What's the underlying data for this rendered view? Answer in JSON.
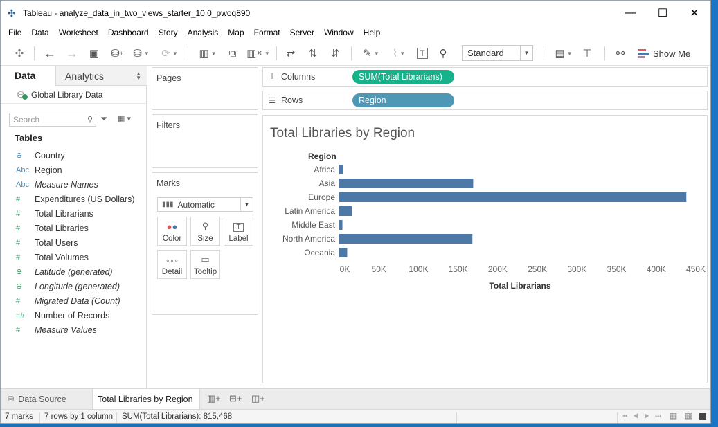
{
  "window": {
    "title": "Tableau - analyze_data_in_two_views_starter_10.0_pwoq890",
    "controls": [
      "—",
      "☐",
      "✕"
    ]
  },
  "menu": [
    "File",
    "Data",
    "Worksheet",
    "Dashboard",
    "Story",
    "Analysis",
    "Map",
    "Format",
    "Server",
    "Window",
    "Help"
  ],
  "toolbar": {
    "fit_select": "Standard",
    "show_me_label": "Show Me",
    "icons": [
      "tableau-logo-icon",
      "undo-icon",
      "redo-icon",
      "save-icon",
      "new-datasource-icon",
      "pause-updates-icon",
      "refresh-icon",
      "new-worksheet-icon",
      "duplicate-sheet-icon",
      "clear-sheet-icon",
      "swap-rows-columns-icon",
      "sort-ascending-icon",
      "sort-descending-icon",
      "highlight-icon",
      "group-members-icon",
      "show-labels-icon",
      "pin-axes-icon",
      "show-cards-icon",
      "presentation-mode-icon",
      "share-icon"
    ]
  },
  "data_pane": {
    "tab_data": "Data",
    "tab_analytics": "Analytics",
    "datasource_name": "Global Library Data",
    "search_placeholder": "Search",
    "tables_heading": "Tables",
    "fields": [
      {
        "icon": "⊕",
        "label": "Country",
        "kind": "dim",
        "italic": false
      },
      {
        "icon": "Abc",
        "label": "Region",
        "kind": "dim",
        "italic": false
      },
      {
        "icon": "Abc",
        "label": "Measure Names",
        "kind": "dim",
        "italic": true
      },
      {
        "icon": "#",
        "label": "Expenditures  (US Dollars)",
        "kind": "mea",
        "italic": false
      },
      {
        "icon": "#",
        "label": "Total Librarians",
        "kind": "mea",
        "italic": false
      },
      {
        "icon": "#",
        "label": "Total Libraries",
        "kind": "mea",
        "italic": false
      },
      {
        "icon": "#",
        "label": "Total Users",
        "kind": "mea",
        "italic": false
      },
      {
        "icon": "#",
        "label": "Total Volumes",
        "kind": "mea",
        "italic": false
      },
      {
        "icon": "⊕",
        "label": "Latitude (generated)",
        "kind": "mea",
        "italic": true
      },
      {
        "icon": "⊕",
        "label": "Longitude (generated)",
        "kind": "mea",
        "italic": true
      },
      {
        "icon": "#",
        "label": "Migrated Data (Count)",
        "kind": "mea",
        "italic": true
      },
      {
        "icon": "=#",
        "label": "Number of Records",
        "kind": "mea",
        "italic": false
      },
      {
        "icon": "#",
        "label": "Measure Values",
        "kind": "mea",
        "italic": true
      }
    ]
  },
  "cards": {
    "pages": "Pages",
    "filters": "Filters",
    "marks": "Marks",
    "mark_type": "Automatic",
    "mark_buttons": [
      {
        "label": "Color",
        "icon": "color-icon"
      },
      {
        "label": "Size",
        "icon": "size-icon"
      },
      {
        "label": "Label",
        "icon": "label-icon"
      },
      {
        "label": "Detail",
        "icon": "detail-icon"
      },
      {
        "label": "Tooltip",
        "icon": "tooltip-icon"
      }
    ]
  },
  "shelves": {
    "columns_label": "Columns",
    "columns_pill": "SUM(Total Librarians)",
    "rows_label": "Rows",
    "rows_pill": "Region",
    "columns_pill_color": "#17b28a",
    "rows_pill_color": "#4f98b5"
  },
  "chart_data": {
    "type": "bar",
    "orientation": "horizontal",
    "title": "Total Libraries by Region",
    "row_header": "Region",
    "categories": [
      "Africa",
      "Asia",
      "Europe",
      "Latin America",
      "Middle East",
      "North America",
      "Oceania"
    ],
    "values": [
      5000,
      169000,
      438000,
      16000,
      4000,
      168000,
      10000
    ],
    "xlabel": "Total Librarians",
    "xlim": [
      0,
      450000
    ],
    "xticks": [
      "0K",
      "50K",
      "100K",
      "150K",
      "200K",
      "250K",
      "300K",
      "350K",
      "400K",
      "450K"
    ],
    "bar_color": "#4e79a7",
    "grid": false
  },
  "sheet_tabs": {
    "datasource_tab": "Data Source",
    "active_sheet": "Total Libraries by Region"
  },
  "status": {
    "marks": "7 marks",
    "rows_cols": "7 rows by 1 column",
    "sum": "SUM(Total Librarians): 815,468"
  }
}
